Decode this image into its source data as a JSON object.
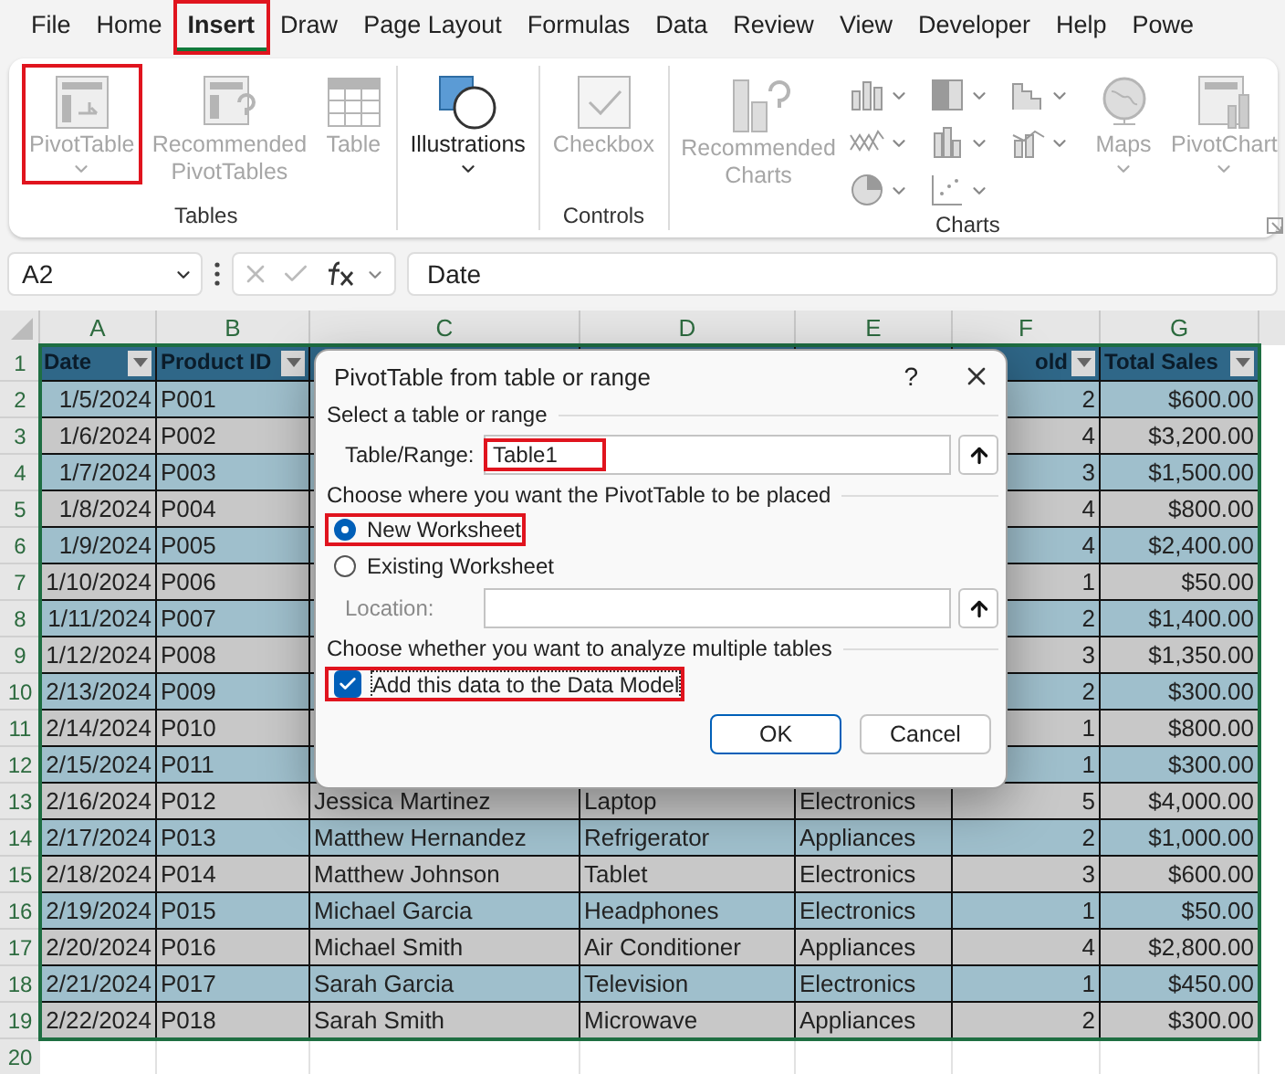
{
  "ribbon_tabs": [
    {
      "label": "File",
      "selected": false,
      "highlighted": false
    },
    {
      "label": "Home",
      "selected": false,
      "highlighted": false
    },
    {
      "label": "Insert",
      "selected": true,
      "highlighted": true
    },
    {
      "label": "Draw",
      "selected": false,
      "highlighted": false
    },
    {
      "label": "Page Layout",
      "selected": false,
      "highlighted": false
    },
    {
      "label": "Formulas",
      "selected": false,
      "highlighted": false
    },
    {
      "label": "Data",
      "selected": false,
      "highlighted": false
    },
    {
      "label": "Review",
      "selected": false,
      "highlighted": false
    },
    {
      "label": "View",
      "selected": false,
      "highlighted": false
    },
    {
      "label": "Developer",
      "selected": false,
      "highlighted": false
    },
    {
      "label": "Help",
      "selected": false,
      "highlighted": false
    },
    {
      "label": "Powe",
      "selected": false,
      "highlighted": false
    }
  ],
  "ribbon_groups": [
    {
      "label": "Tables",
      "commands": [
        {
          "kind": "large",
          "label": "PivotTable",
          "disabled": true,
          "dropdown": true,
          "highlighted": true
        },
        {
          "kind": "large",
          "label": "Recommended PivotTables",
          "disabled": true,
          "dropdown": false,
          "highlighted": false
        },
        {
          "kind": "large",
          "label": "Table",
          "disabled": true,
          "dropdown": false,
          "highlighted": false
        }
      ]
    },
    {
      "commands": [
        {
          "kind": "large",
          "label": "Illustrations",
          "disabled": false,
          "dropdown": true,
          "highlighted": false
        }
      ]
    },
    {
      "label": "Controls",
      "commands": [
        {
          "kind": "large",
          "label": "Checkbox",
          "disabled": true,
          "dropdown": false,
          "highlighted": false
        }
      ]
    },
    {
      "label": "Charts",
      "launcher": true,
      "commands": [
        {
          "kind": "large",
          "label": "Recommended Charts",
          "disabled": true,
          "dropdown": false,
          "highlighted": false
        },
        {
          "kind": "icon_grid",
          "items": [
            {
              "dropdown": true
            },
            {
              "dropdown": true
            },
            {
              "dropdown": true
            },
            {
              "dropdown": true
            },
            {
              "dropdown": true
            },
            {
              "dropdown": true
            },
            {
              "dropdown": true
            },
            {
              "dropdown": true
            }
          ]
        },
        {
          "kind": "large",
          "label": "Maps",
          "disabled": true,
          "dropdown": true,
          "highlighted": false
        },
        {
          "kind": "large",
          "label": "PivotChart",
          "disabled": true,
          "dropdown": true,
          "highlighted": false
        }
      ]
    }
  ],
  "formula_bar": {
    "name_box": "A2",
    "formula": "Date"
  },
  "sheet": {
    "columns": [
      "A",
      "B",
      "C",
      "D",
      "E",
      "F",
      "G"
    ],
    "header_row": {
      "row": "1",
      "date": "Date",
      "product_id": "Product ID",
      "units": "old",
      "total": "Total Sales"
    },
    "rows": [
      {
        "row": "2",
        "date": "1/5/2024",
        "product_id": "P001",
        "units": "2",
        "total": "$600.00"
      },
      {
        "row": "3",
        "date": "1/6/2024",
        "product_id": "P002",
        "units": "4",
        "total": "$3,200.00"
      },
      {
        "row": "4",
        "date": "1/7/2024",
        "product_id": "P003",
        "units": "3",
        "total": "$1,500.00"
      },
      {
        "row": "5",
        "date": "1/8/2024",
        "product_id": "P004",
        "units": "4",
        "total": "$800.00"
      },
      {
        "row": "6",
        "date": "1/9/2024",
        "product_id": "P005",
        "units": "4",
        "total": "$2,400.00"
      },
      {
        "row": "7",
        "date": "1/10/2024",
        "product_id": "P006",
        "units": "1",
        "total": "$50.00"
      },
      {
        "row": "8",
        "date": "1/11/2024",
        "product_id": "P007",
        "units": "2",
        "total": "$1,400.00"
      },
      {
        "row": "9",
        "date": "1/12/2024",
        "product_id": "P008",
        "units": "3",
        "total": "$1,350.00"
      },
      {
        "row": "10",
        "date": "2/13/2024",
        "product_id": "P009",
        "units": "2",
        "total": "$300.00"
      },
      {
        "row": "11",
        "date": "2/14/2024",
        "product_id": "P010",
        "units": "1",
        "total": "$800.00"
      },
      {
        "row": "12",
        "date": "2/15/2024",
        "product_id": "P011",
        "units": "1",
        "total": "$300.00"
      },
      {
        "row": "13",
        "date": "2/16/2024",
        "product_id": "P012",
        "customer": "Jessica Martinez",
        "product": "Laptop",
        "category": "Electronics",
        "units": "5",
        "total": "$4,000.00"
      },
      {
        "row": "14",
        "date": "2/17/2024",
        "product_id": "P013",
        "customer": "Matthew Hernandez",
        "product": "Refrigerator",
        "category": "Appliances",
        "units": "2",
        "total": "$1,000.00"
      },
      {
        "row": "15",
        "date": "2/18/2024",
        "product_id": "P014",
        "customer": "Matthew Johnson",
        "product": "Tablet",
        "category": "Electronics",
        "units": "3",
        "total": "$600.00"
      },
      {
        "row": "16",
        "date": "2/19/2024",
        "product_id": "P015",
        "customer": "Michael Garcia",
        "product": "Headphones",
        "category": "Electronics",
        "units": "1",
        "total": "$50.00"
      },
      {
        "row": "17",
        "date": "2/20/2024",
        "product_id": "P016",
        "customer": "Michael Smith",
        "product": "Air Conditioner",
        "category": "Appliances",
        "units": "4",
        "total": "$2,800.00"
      },
      {
        "row": "18",
        "date": "2/21/2024",
        "product_id": "P017",
        "customer": "Sarah Garcia",
        "product": "Television",
        "category": "Electronics",
        "units": "1",
        "total": "$450.00"
      },
      {
        "row": "19",
        "date": "2/22/2024",
        "product_id": "P018",
        "customer": "Sarah Smith",
        "product": "Microwave",
        "category": "Appliances",
        "units": "2",
        "total": "$300.00"
      }
    ],
    "empty_rows": [
      "20"
    ]
  },
  "dialog": {
    "title": "PivotTable from table or range",
    "help": "?",
    "source_heading": "Select a table or range",
    "table_range": {
      "label": "Table/Range:",
      "value": "Table1",
      "highlighted": true
    },
    "placement_heading": "Choose where you want the PivotTable to be placed",
    "placement_options": [
      {
        "label": "New Worksheet",
        "selected": true,
        "highlighted": true
      },
      {
        "label": "Existing Worksheet",
        "selected": false,
        "highlighted": false
      }
    ],
    "location": {
      "label": "Location:",
      "disabled": true
    },
    "model_heading": "Choose whether you want to analyze multiple tables",
    "data_model": {
      "label": "Add this data to the Data Model",
      "checked": true,
      "highlighted": true
    },
    "buttons": [
      {
        "label": "OK",
        "default": true
      },
      {
        "label": "Cancel",
        "default": false
      }
    ]
  }
}
